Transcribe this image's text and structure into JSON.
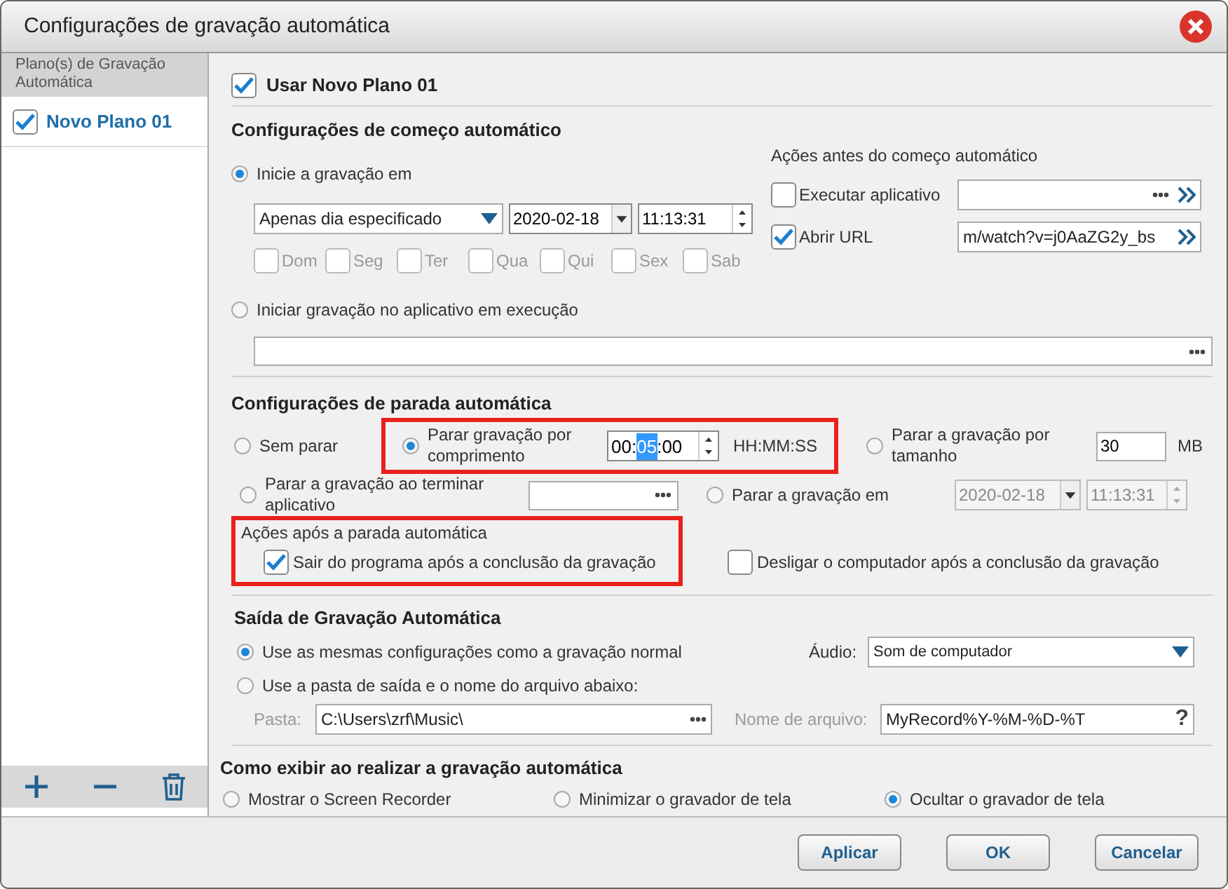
{
  "window": {
    "title": "Configurações de gravação automática"
  },
  "sidebar": {
    "header": "Plano(s) de Gravação Automática",
    "items": [
      {
        "label": "Novo Plano 01",
        "checked": true,
        "selected": true
      }
    ]
  },
  "plan": {
    "label": "Usar Novo Plano 01",
    "checked": true
  },
  "start": {
    "title": "Configurações de começo automático",
    "options": [
      {
        "label": "Inicie a gravação em",
        "selected": true
      },
      {
        "label": "Iniciar gravação no aplicativo em execução",
        "selected": false
      }
    ],
    "schedule": "Apenas dia especificado",
    "date": "2020-02-18",
    "time": "11:13:31",
    "days": [
      {
        "label": "Dom",
        "checked": false
      },
      {
        "label": "Seg",
        "checked": false
      },
      {
        "label": "Ter",
        "checked": false
      },
      {
        "label": "Qua",
        "checked": false
      },
      {
        "label": "Qui",
        "checked": false
      },
      {
        "label": "Sex",
        "checked": false
      },
      {
        "label": "Sab",
        "checked": false
      }
    ],
    "actions_title": "Ações antes do começo automático",
    "actions": [
      {
        "kind": "browse",
        "label": "Executar aplicativo",
        "checked": false
      },
      {
        "kind": "url",
        "label": "Abrir URL",
        "checked": true,
        "value": "m/watch?v=j0AaZG2y_bs"
      }
    ]
  },
  "stop": {
    "title": "Configurações de parada automática",
    "options": [
      {
        "kind": "plain",
        "label": "Sem parar",
        "selected": false
      },
      {
        "kind": "duration",
        "label": "Parar gravação por comprimento",
        "selected": true,
        "highlighted": true,
        "parts": [
          {
            "text": "00",
            "selected": false
          },
          {
            "text": ":",
            "selected": false
          },
          {
            "text": "05",
            "selected": true
          },
          {
            "text": ":",
            "selected": false
          },
          {
            "text": "00",
            "selected": false
          }
        ],
        "unit": "HH:MM:SS"
      },
      {
        "kind": "size",
        "label": "Parar a gravação por tamanho",
        "selected": false,
        "value": "30",
        "unit": "MB"
      },
      {
        "kind": "app",
        "label": "Parar a gravação ao terminar aplicativo",
        "selected": false
      },
      {
        "kind": "datetime",
        "label": "Parar a gravação em",
        "selected": false,
        "date": "2020-02-18",
        "time": "11:13:31"
      }
    ]
  },
  "after_stop": {
    "title": "Ações após a parada automática",
    "highlighted": true,
    "actions": [
      {
        "label": "Sair do programa após a conclusão da gravação",
        "checked": true
      },
      {
        "label": "Desligar o computador após a conclusão da gravação",
        "checked": false
      }
    ]
  },
  "output": {
    "title": "Saída de Gravação Automática",
    "options": [
      {
        "label": "Use as mesmas configurações como a gravação normal",
        "selected": true
      },
      {
        "label": "Use a pasta de saída e o nome do arquivo abaixo:",
        "selected": false
      }
    ],
    "audio_label": "Áudio:",
    "audio": "Som de computador",
    "folder_label": "Pasta:",
    "folder": "C:\\Users\\zrf\\Music\\",
    "filename_label": "Nome de arquivo:",
    "filename": "MyRecord%Y-%M-%D-%T",
    "help": "?"
  },
  "display": {
    "title": "Como exibir ao realizar a gravação automática",
    "options": [
      {
        "label": "Mostrar o Screen Recorder",
        "selected": false
      },
      {
        "label": "Minimizar o gravador de tela",
        "selected": false
      },
      {
        "label": "Ocultar o gravador de tela",
        "selected": true
      }
    ]
  },
  "buttons": [
    "Aplicar",
    "OK",
    "Cancelar"
  ]
}
